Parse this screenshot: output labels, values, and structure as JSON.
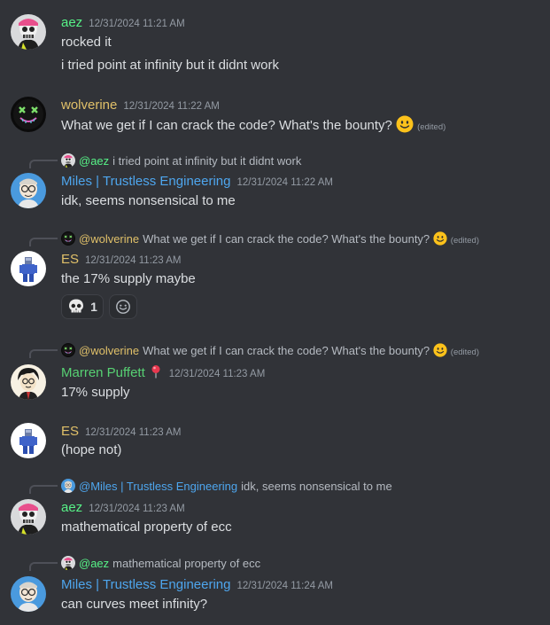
{
  "colors": {
    "background": "#313338",
    "text": "#dbdee1",
    "muted": "#949ba4",
    "aez": "#57f287",
    "wolverine": "#e0c069",
    "miles": "#4ea6ee",
    "es": "#e0c069",
    "marren": "#57d173"
  },
  "messages": [
    {
      "user": "aez",
      "timestamp": "12/31/2024 11:21 AM",
      "lines": [
        "rocked it",
        "i tried point at infinity but it didnt work"
      ]
    },
    {
      "user": "wolverine",
      "timestamp": "12/31/2024 11:22 AM",
      "text": "What we get if I can crack the code? What's the bounty?",
      "emoji": "slightly-smiling-face",
      "edited": "(edited)"
    },
    {
      "reply": {
        "name": "@aez",
        "text": "i tried point at infinity but it didnt work"
      },
      "user": "Miles | Trustless Engineering",
      "timestamp": "12/31/2024 11:22 AM",
      "text": "idk, seems nonsensical to me"
    },
    {
      "reply": {
        "name": "@wolverine",
        "text": "What we get if I can crack the code? What's the bounty?",
        "edited": "(edited)"
      },
      "user": "ES",
      "timestamp": "12/31/2024 11:23 AM",
      "text": "the 17% supply maybe",
      "reactions": [
        {
          "emoji": "skull",
          "count": "1"
        }
      ]
    },
    {
      "reply": {
        "name": "@wolverine",
        "text": "What we get if I can crack the code? What's the bounty?",
        "edited": "(edited)"
      },
      "user": "Marren Puffett",
      "user_badge": "pushpin-icon",
      "timestamp": "12/31/2024 11:23 AM",
      "text": "17% supply"
    },
    {
      "user": "ES",
      "timestamp": "12/31/2024 11:23 AM",
      "text": "(hope not)"
    },
    {
      "reply": {
        "name": "@Miles | Trustless Engineering",
        "text": "idk, seems nonsensical to me"
      },
      "user": "aez",
      "timestamp": "12/31/2024 11:23 AM",
      "text": "mathematical property of ecc"
    },
    {
      "reply": {
        "name": "@aez",
        "text": "mathematical property of ecc"
      },
      "user": "Miles | Trustless Engineering",
      "timestamp": "12/31/2024 11:24 AM",
      "text": "can curves meet infinity?"
    }
  ]
}
